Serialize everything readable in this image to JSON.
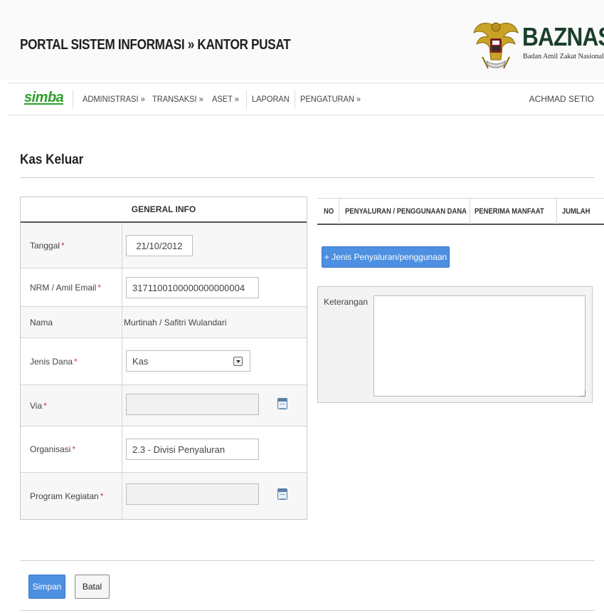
{
  "header": {
    "portal_title": "PORTAL SISTEM INFORMASI  »  KANTOR PUSAT",
    "brand_name": "BAZNAS",
    "brand_subtitle": "Badan Amil Zakat Nasional"
  },
  "nav": {
    "logo": "simba",
    "items": [
      "ADMINISTRASI »",
      "TRANSAKSI »",
      "ASET »",
      "LAPORAN",
      "PENGATURAN »"
    ],
    "user": "ACHMAD SETIO"
  },
  "page": {
    "title": "Kas Keluar"
  },
  "general_info": {
    "header": "GENERAL INFO",
    "tanggal_label": "Tanggal",
    "tanggal_value": "21/10/2012",
    "nrm_label": "NRM / Amil Email",
    "nrm_value": "3171100100000000000004",
    "nama_label": "Nama",
    "nama_value": "Murtinah / Safitri Wulandari",
    "jenis_label": "Jenis Dana",
    "jenis_value": "Kas",
    "via_label": "Via",
    "via_value": "",
    "organisasi_label": "Organisasi",
    "organisasi_value": "2.3 - Divisi Penyaluran",
    "program_label": "Program Kegiatan",
    "program_value": "",
    "required_mark": "*"
  },
  "distribution_table": {
    "columns": [
      "NO",
      "PENYALURAN / PENGGUNAAN DANA",
      "PENERIMA MANFAAT",
      "JUMLAH"
    ],
    "add_button": "+ Jenis Penyaluran/penggunaan"
  },
  "keterangan": {
    "label": "Keterangan",
    "value": ""
  },
  "actions": {
    "save": "Simpan",
    "cancel": "Batal"
  },
  "colors": {
    "primary_button": "#4d8fe0",
    "logo_green": "#2e9e2e",
    "brand_dark": "#1b3e2c"
  }
}
